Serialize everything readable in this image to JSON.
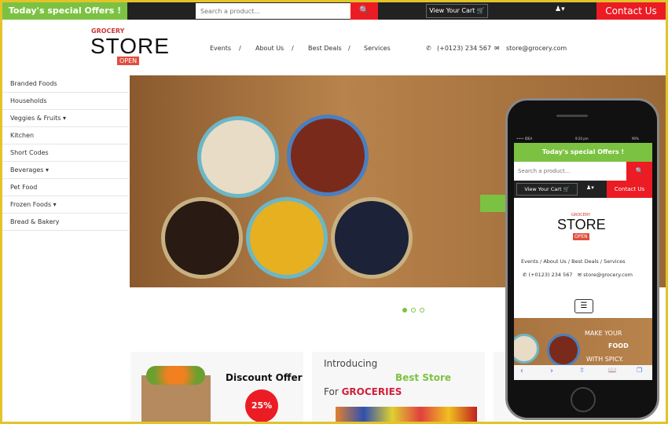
{
  "topbar": {
    "offer": "Today's special Offers !",
    "search_placeholder": "Search a product...",
    "cart": "View Your Cart",
    "contact": "Contact Us"
  },
  "logo": {
    "small": "GROCERY",
    "big": "STORE",
    "sign": "OPEN"
  },
  "nav": [
    "Events",
    "About Us",
    "Best Deals",
    "Services"
  ],
  "separator": "/",
  "contact_info": {
    "phone": "(+0123) 234 567",
    "email": "store@grocery.com"
  },
  "sidebar": [
    "Branded Foods",
    "Households",
    "Veggies & Fruits ▾",
    "Kitchen",
    "Short Codes",
    "Beverages ▾",
    "Pet Food",
    "Frozen Foods ▾",
    "Bread & Bakery"
  ],
  "cards": {
    "discount_title": "Discount Offer",
    "discount_value": "25%",
    "intro": "Introducing",
    "best": "Best Store",
    "for": "For",
    "groceries": "GROCERIES"
  },
  "phone": {
    "carrier": "•••• IDEA",
    "time": "9:20 pm",
    "battery": "90%",
    "offer": "Today's special Offers !",
    "search_placeholder": "Search a product...",
    "cart": "View Your Cart",
    "contact": "Contact Us",
    "banner": [
      "MAKE YOUR",
      "FOOD",
      "WITH SPICY."
    ]
  },
  "colors": {
    "green": "#7cc242",
    "red": "#ec1c24",
    "dark": "#222222"
  }
}
